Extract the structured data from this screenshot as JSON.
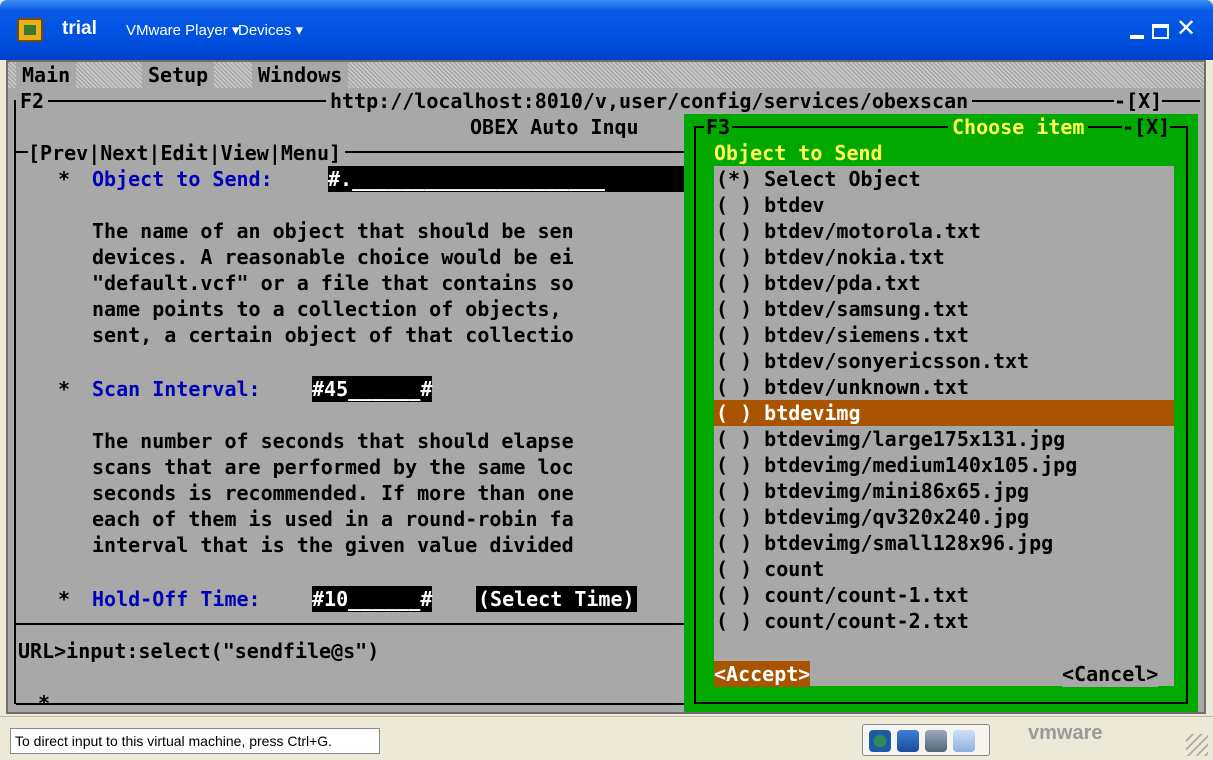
{
  "window": {
    "title": "trial",
    "menus": [
      "VMware Player ▾",
      "Devices ▾"
    ],
    "min": "_",
    "close": "✕"
  },
  "tui": {
    "menubar": [
      "Main",
      "Setup",
      "Windows"
    ],
    "f2": {
      "id": "F2",
      "url": "http://localhost:8010/v,user/config/services/obexscan",
      "close": "-[X]",
      "subtitle": "OBEX Auto Inqu",
      "nav": "[Prev|Next|Edit|View|Menu]"
    },
    "object_field": {
      "label": "Object to Send:",
      "value": "#._____________________",
      "bullet": "*"
    },
    "object_help": [
      "The name of an object that should be sen",
      "devices. A reasonable choice would be ei",
      "\"default.vcf\" or a file that contains so",
      "name points to a collection of objects,",
      "sent, a certain object of that collectio"
    ],
    "scan_field": {
      "label": "Scan Interval:",
      "value": "#45______#",
      "bullet": "*"
    },
    "scan_help": [
      "The number of seconds that should elapse",
      "scans that are performed by the same loc",
      "seconds is recommended. If more than one",
      "each of them is used in a round-robin fa",
      "interval that is the given value divided"
    ],
    "hold_field": {
      "label": "Hold-Off Time:",
      "value": "#10______#",
      "button": "(Select Time)",
      "bullet": "*"
    },
    "url_line": "URL>input:select(\"sendfile@s\")",
    "footer_mark": "*",
    "f3": {
      "id": "F3",
      "title": "Choose item",
      "close": "-[X]",
      "heading": "Object to Send",
      "items": [
        "(*) Select Object",
        "( ) btdev",
        "( ) btdev/motorola.txt",
        "( ) btdev/nokia.txt",
        "( ) btdev/pda.txt",
        "( ) btdev/samsung.txt",
        "( ) btdev/siemens.txt",
        "( ) btdev/sonyericsson.txt",
        "( ) btdev/unknown.txt",
        "( ) btdevimg",
        "( ) btdevimg/large175x131.jpg",
        "( ) btdevimg/medium140x105.jpg",
        "( ) btdevimg/mini86x65.jpg",
        "( ) btdevimg/qv320x240.jpg",
        "( ) btdevimg/small128x96.jpg",
        "( ) count",
        "( ) count/count-1.txt",
        "( ) count/count-2.txt"
      ],
      "selected_index": 9,
      "accept": "<Accept>",
      "cancel": "<Cancel>"
    }
  },
  "statusbar": {
    "text": "To direct input to this virtual machine, press Ctrl+G.",
    "logo": "vmware"
  },
  "colors": {
    "tui_bg": "#a8a8a8",
    "highlight": "#a85400",
    "dialog_green": "#00a800",
    "field_label_blue": "#0000b8",
    "xp_blue": "#0054e3"
  }
}
